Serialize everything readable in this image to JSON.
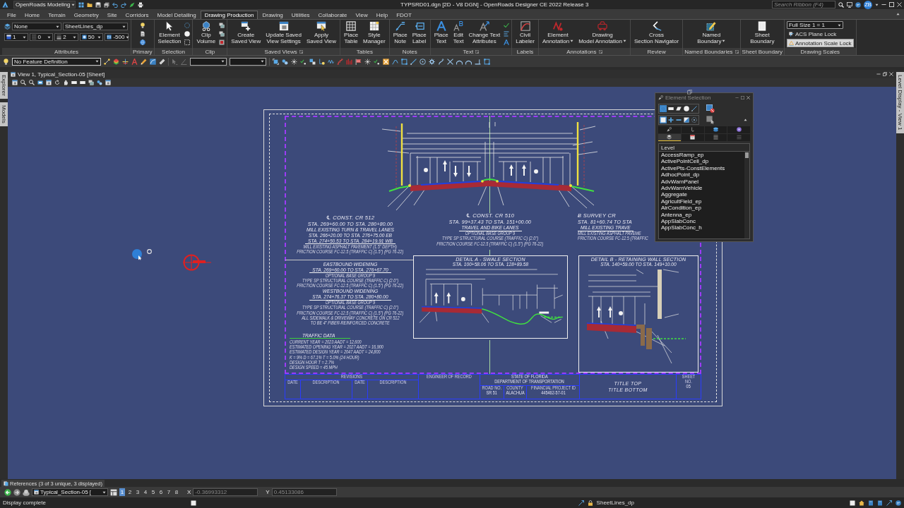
{
  "title_bar": {
    "workflow": "OpenRoads Modeling",
    "title": "TYPSRD01.dgn [2D - V8 DGN] - OpenRoads Designer CE 2022 Release 3",
    "search": {
      "placeholder": "Search Ribbon (F4)"
    },
    "user_initials": "ZB"
  },
  "ribbon_tabs": [
    {
      "label": "File",
      "selected": false
    },
    {
      "label": "Home",
      "selected": false
    },
    {
      "label": "Terrain",
      "selected": false
    },
    {
      "label": "Geometry",
      "selected": false
    },
    {
      "label": "Site",
      "selected": false
    },
    {
      "label": "Corridors",
      "selected": false
    },
    {
      "label": "Model Detailing",
      "selected": false
    },
    {
      "label": "Drawing Production",
      "selected": true
    },
    {
      "label": "Drawing",
      "selected": false
    },
    {
      "label": "Utilities",
      "selected": false
    },
    {
      "label": "Collaborate",
      "selected": false
    },
    {
      "label": "View",
      "selected": false
    },
    {
      "label": "Help",
      "selected": false
    },
    {
      "label": "FDOT",
      "selected": false
    }
  ],
  "ribbon_groups": [
    {
      "kind": "attributes",
      "label": "Attributes",
      "element_template": "None",
      "level": "SheetLines_dp",
      "settings": [
        "1",
        "0",
        "2",
        "50",
        "-500"
      ]
    },
    {
      "kind": "icons",
      "label": "Primary"
    },
    {
      "kind": "buttons",
      "label": "Selection",
      "buttons": [
        {
          "label": "Element\nSelection",
          "dropdown": false
        }
      ]
    },
    {
      "kind": "buttons",
      "label": "Clip",
      "buttons": [
        {
          "label": "Clip\nVolume",
          "dropdown": false
        }
      ]
    },
    {
      "kind": "buttons",
      "label": "Saved Views",
      "buttons": [
        {
          "label": "Create\nSaved View",
          "dropdown": false
        },
        {
          "label": "Update Saved\nView Settings",
          "dropdown": false
        },
        {
          "label": "Apply\nSaved View",
          "dropdown": false
        }
      ]
    },
    {
      "kind": "buttons",
      "label": "Tables",
      "buttons": [
        {
          "label": "Place\nTable",
          "dropdown": false
        },
        {
          "label": "Style\nManager",
          "dropdown": false
        }
      ]
    },
    {
      "kind": "buttons",
      "label": "Notes",
      "buttons": [
        {
          "label": "Place\nNote",
          "dropdown": false
        },
        {
          "label": "Place\nLabel",
          "dropdown": false
        }
      ]
    },
    {
      "kind": "buttons",
      "label": "Text",
      "buttons": [
        {
          "label": "Place\nText",
          "dropdown": false
        },
        {
          "label": "Edit\nText",
          "dropdown": false
        },
        {
          "label": "Change Text\nAttributes",
          "dropdown": false
        }
      ]
    },
    {
      "kind": "buttons",
      "label": "Labels",
      "buttons": [
        {
          "label": "Civil\nLabeler",
          "dropdown": false
        }
      ]
    },
    {
      "kind": "buttons",
      "label": "Annotations",
      "buttons": [
        {
          "label": "Element\nAnnotation",
          "dropdown": true
        },
        {
          "label": "Drawing\nModel Annotation",
          "dropdown": true
        }
      ]
    },
    {
      "kind": "buttons",
      "label": "Review",
      "buttons": [
        {
          "label": "Cross\nSection Navigator",
          "dropdown": false
        }
      ]
    },
    {
      "kind": "buttons",
      "label": "Named Boundaries",
      "buttons": [
        {
          "label": "Named\nBoundary",
          "dropdown": true
        }
      ]
    },
    {
      "kind": "buttons",
      "label": "Sheet Boundary",
      "buttons": [
        {
          "label": "Sheet\nBoundary",
          "dropdown": false
        }
      ]
    },
    {
      "kind": "scales",
      "label": "Drawing Scales",
      "scale": "Full Size 1 = 1",
      "toggles": [
        {
          "label": "ACS Plane Lock",
          "on": false
        },
        {
          "label": "Annotation Scale Lock",
          "on": true
        }
      ]
    }
  ],
  "toolbar": {
    "feature_definition": "No Feature Definition"
  },
  "left_dock_tabs": [
    "Explorer",
    "Models"
  ],
  "right_dock_tabs": [
    "Level Display - View 1"
  ],
  "view_window": {
    "title": "View 1, Typical_Section-05 [Sheet]"
  },
  "sheet": {
    "blocks": [
      {
        "lines": [
          {
            "kind": "heading",
            "text": "℄ CONST. CR 512"
          },
          {
            "kind": "station",
            "text": "STA. 269+60.00 TO STA. 280+80.00"
          },
          {
            "kind": "subheading",
            "text": "MILL EXISTING TURN & TRAVEL LANES"
          },
          {
            "kind": "subheading",
            "text": "STA. 266+20.00 TO STA. 276+75.00 EB"
          },
          {
            "kind": "underlined",
            "text": "STA. 274+50.53 TO STA. 284+19.91 WB"
          },
          {
            "kind": "note",
            "text": "MILL EXISTING ASPHALT PAVEMENT (1.5\" DEPTH)"
          },
          {
            "kind": "note",
            "text": "FRICTION COURSE FC-12.5 (TRAFFIC C) (1.5\") (PG 76-22)"
          }
        ]
      },
      {
        "lines": [
          {
            "kind": "subheading",
            "text": "EASTBOUND WIDENING"
          },
          {
            "kind": "underlined",
            "text": "STA. 269+60.00 TO STA. 276+67.70"
          },
          {
            "kind": "note",
            "text": "OPTIONAL BASE GROUP 9"
          },
          {
            "kind": "note",
            "text": "TYPE SP STRUCTURAL COURSE (TRAFFIC C) (2.0\")"
          },
          {
            "kind": "note",
            "text": "FRICTION COURSE FC-12.5 (TRAFFIC C) (1.5\") (PG 76-22)"
          },
          {
            "kind": "subheading",
            "text": "WESTBOUND WIDENING"
          },
          {
            "kind": "underlined",
            "text": "STA. 274+76.37 TO STA. 280+80.00"
          },
          {
            "kind": "note",
            "text": "OPTIONAL BASE GROUP 9"
          },
          {
            "kind": "note",
            "text": "TYPE SP STRUCTURAL COURSE (TRAFFIC C) (2.0\")"
          },
          {
            "kind": "note",
            "text": "FRICTION COURSE FC-12.5 (TRAFFIC C) (1.5\") (PG 76-22)"
          },
          {
            "kind": "note",
            "text": "ALL SIDEWALK & DRIVEWAY CONCRETE ON CR 512"
          },
          {
            "kind": "note",
            "text": "TO BE 4\" FIBER-REINFORCED CONCRETE"
          }
        ]
      },
      {
        "lines": [
          {
            "kind": "heading",
            "text": "℄ CONST. CR 510"
          },
          {
            "kind": "station",
            "text": "STA. 99+37.43 TO STA. 151+00.00"
          },
          {
            "kind": "underlined",
            "text": "TRAVEL AND BIKE LANES"
          },
          {
            "kind": "note",
            "text": "OPTIONAL BASE GROUP 9"
          },
          {
            "kind": "note",
            "text": "TYPE SP STRUCTURAL COURSE (TRAFFIC C) (2.0\")"
          },
          {
            "kind": "note",
            "text": "FRICTION COURSE FC-12.5 (TRAFFIC C) (1.5\") (PG 76-22)"
          }
        ]
      },
      {
        "lines": [
          {
            "kind": "heading",
            "text": "Ƀ SURVEY CR"
          },
          {
            "kind": "station",
            "text": "STA. 81+60.74 TO STA"
          },
          {
            "kind": "underlined",
            "text": "MILL EXISTING TRAVE"
          },
          {
            "kind": "note",
            "text": "MILL EXISTING ASPHALT PAVEME"
          },
          {
            "kind": "note",
            "text": "FRICTION COURSE FC-12.5 (TRAFFIC"
          }
        ]
      },
      {
        "lines": [
          {
            "kind": "dataheading",
            "text": "TRAFFIC DATA"
          },
          {
            "kind": "data",
            "text": "CURRENT YEAR = 2023 AADT = 12,600"
          },
          {
            "kind": "data",
            "text": "ESTIMATED OPENING YEAR = 2027 AADT = 16,900"
          },
          {
            "kind": "data",
            "text": "ESTIMATED DESIGN YEAR = 2047 AADT = 24,800"
          },
          {
            "kind": "data",
            "text": "K = 9%  D = 67.1%  T = 5.0% (24 HOUR)"
          },
          {
            "kind": "data",
            "text": "DESIGN HOUR T = 2.7%"
          },
          {
            "kind": "data",
            "text": "DESIGN SPEED = 45 MPH"
          }
        ]
      }
    ],
    "details": [
      {
        "title": "DETAIL A - SWALE SECTION",
        "stations": "STA. 100+58.06 TO STA. 128+89.58"
      },
      {
        "title": "DETAIL B - RETAINING WALL SECTION",
        "stations": "STA. 140+59.00 TO STA. 149+10.00"
      }
    ],
    "title_block": {
      "revisions_label": "REVISIONS",
      "revision_columns": [
        "DATE",
        "DESCRIPTION",
        "DATE",
        "DESCRIPTION"
      ],
      "engineer_label": "ENGINEER OF RECORD",
      "agency": [
        "STATE OF FLORIDA",
        "DEPARTMENT OF TRANSPORTATION"
      ],
      "fields": [
        {
          "label": "ROAD NO.",
          "value": "SR 51"
        },
        {
          "label": "COUNTY",
          "value": "ALACHUA"
        },
        {
          "label": "FINANCIAL PROJECT ID",
          "value": "445462-57-01"
        }
      ],
      "title_lines": [
        "TITLE TOP",
        "TITLE BOTTOM"
      ],
      "sheet_label": "SHEET NO.",
      "sheet_number": "05"
    }
  },
  "element_selection": {
    "title": "Element Selection",
    "method_tools": [
      {
        "selected": true
      },
      {
        "selected": false
      },
      {
        "selected": false
      },
      {
        "selected": false
      },
      {
        "selected": false
      }
    ],
    "mode_tools": [
      {
        "selected": true
      },
      {
        "selected": false
      },
      {
        "selected": false
      },
      {
        "selected": false
      },
      {
        "selected": false
      }
    ],
    "tabs": [
      {
        "selected": false
      },
      {
        "selected": false
      },
      {
        "selected": false
      },
      {
        "selected": false
      },
      {
        "selected": true
      },
      {
        "selected": false
      },
      {
        "selected": false
      },
      {
        "selected": false
      }
    ],
    "list_header": "Level",
    "levels": [
      "AccessRamp_ep",
      "ActivePointCell_dp",
      "ActivePts-ConstElements",
      "AdhocPoint_dp",
      "AdvWarnPanel",
      "AdvWarnVehicle",
      "Aggregate",
      "AgricultField_ep",
      "AirCondition_ep",
      "Antenna_ep",
      "AppSlabConc",
      "AppSlabConc_h"
    ]
  },
  "references_tab": "References (3 of 3 unique, 3 displayed)",
  "view_bar": {
    "model": "Typical_Section-05 [",
    "views": [
      {
        "label": "1",
        "selected": true
      },
      {
        "label": "2",
        "selected": false
      },
      {
        "label": "3",
        "selected": false
      },
      {
        "label": "4",
        "selected": false
      },
      {
        "label": "5",
        "selected": false
      },
      {
        "label": "6",
        "selected": false
      },
      {
        "label": "7",
        "selected": false
      },
      {
        "label": "8",
        "selected": false
      }
    ],
    "x_label": "X",
    "x_value": "-0.36993312",
    "y_label": "Y",
    "y_value": "0.45133086"
  },
  "status_bar": {
    "message": "Display complete",
    "active_level": "SheetLines_dp"
  }
}
